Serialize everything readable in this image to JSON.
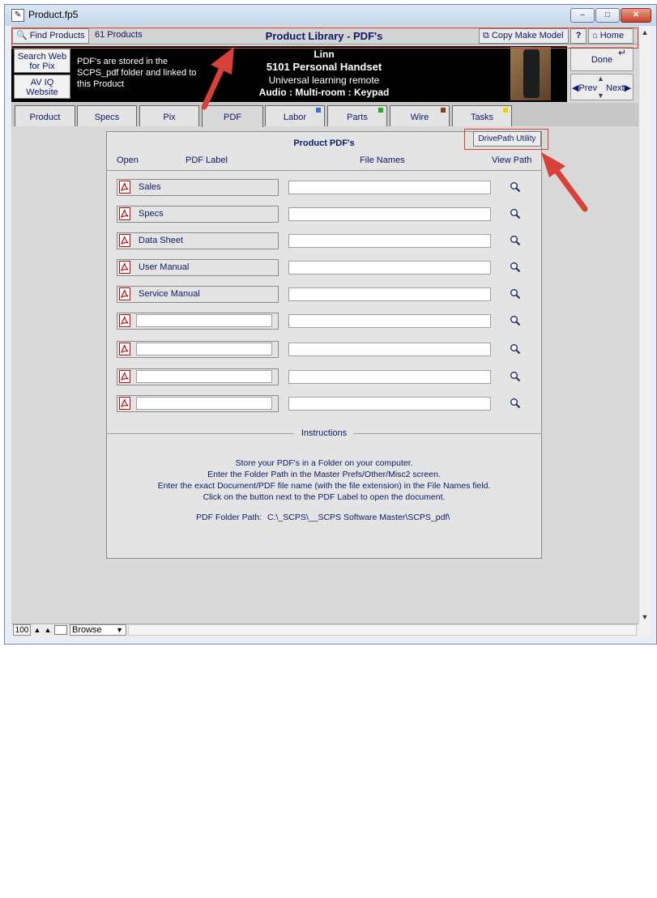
{
  "window": {
    "title": "Product.fp5",
    "min_glyph": "–",
    "max_glyph": "□",
    "close_glyph": "✕"
  },
  "toolbar": {
    "find_label": "Find Products",
    "count_label": "61 Products",
    "library_title": "Product Library - PDF's",
    "copy_label": "Copy Make Model",
    "help_label": "?",
    "home_label": "Home"
  },
  "band": {
    "web_btn": "Search Web for Pix",
    "aviq_btn": "AV IQ Website",
    "note": "PDF's are stored in the SCPS_pdf folder and linked to this Product",
    "brand": "Linn",
    "model": "5101 Personal Handset",
    "description": "Universal learning remote",
    "category": "Audio : Multi-room : Keypad",
    "done_label": "Done",
    "prev_label": "Prev",
    "next_label": "Next"
  },
  "tabs": [
    {
      "label": "Product"
    },
    {
      "label": "Specs"
    },
    {
      "label": "Pix"
    },
    {
      "label": "PDF"
    },
    {
      "label": "Labor"
    },
    {
      "label": "Parts"
    },
    {
      "label": "Wire"
    },
    {
      "label": "Tasks"
    }
  ],
  "tab_marker_colors": {
    "labor": "#3a6fe0",
    "parts": "#1fae1f",
    "wire": "#8a3a1a",
    "tasks": "#f0d000"
  },
  "panel": {
    "heading": "Product PDF's",
    "drivepath_label": "DrivePath Utility",
    "col_open": "Open",
    "col_label": "PDF Label",
    "col_files": "File Names",
    "col_view": "View Path",
    "rows": [
      {
        "label": "Sales",
        "file": ""
      },
      {
        "label": "Specs",
        "file": ""
      },
      {
        "label": "Data Sheet",
        "file": ""
      },
      {
        "label": "User Manual",
        "file": ""
      },
      {
        "label": "Service Manual",
        "file": ""
      },
      {
        "label": "",
        "file": ""
      },
      {
        "label": "",
        "file": ""
      },
      {
        "label": "",
        "file": ""
      },
      {
        "label": "",
        "file": ""
      }
    ],
    "instructions_title": "Instructions",
    "instructions": [
      "Store your PDF's in a Folder on your computer.",
      "Enter the Folder Path in the Master Prefs/Other/Misc2 screen.",
      "Enter the exact Document/PDF file name (with the file extension) in the File Names field.",
      "Click on the button next to the PDF Label to open the document."
    ],
    "folder_label": "PDF Folder Path:",
    "folder_path": "C:\\_SCPS\\__SCPS Software Master\\SCPS_pdf\\"
  },
  "status": {
    "zoom": "100",
    "mode": "Browse"
  },
  "colors": {
    "annotation": "#d8403a",
    "text_navy": "#0a1a6a"
  }
}
